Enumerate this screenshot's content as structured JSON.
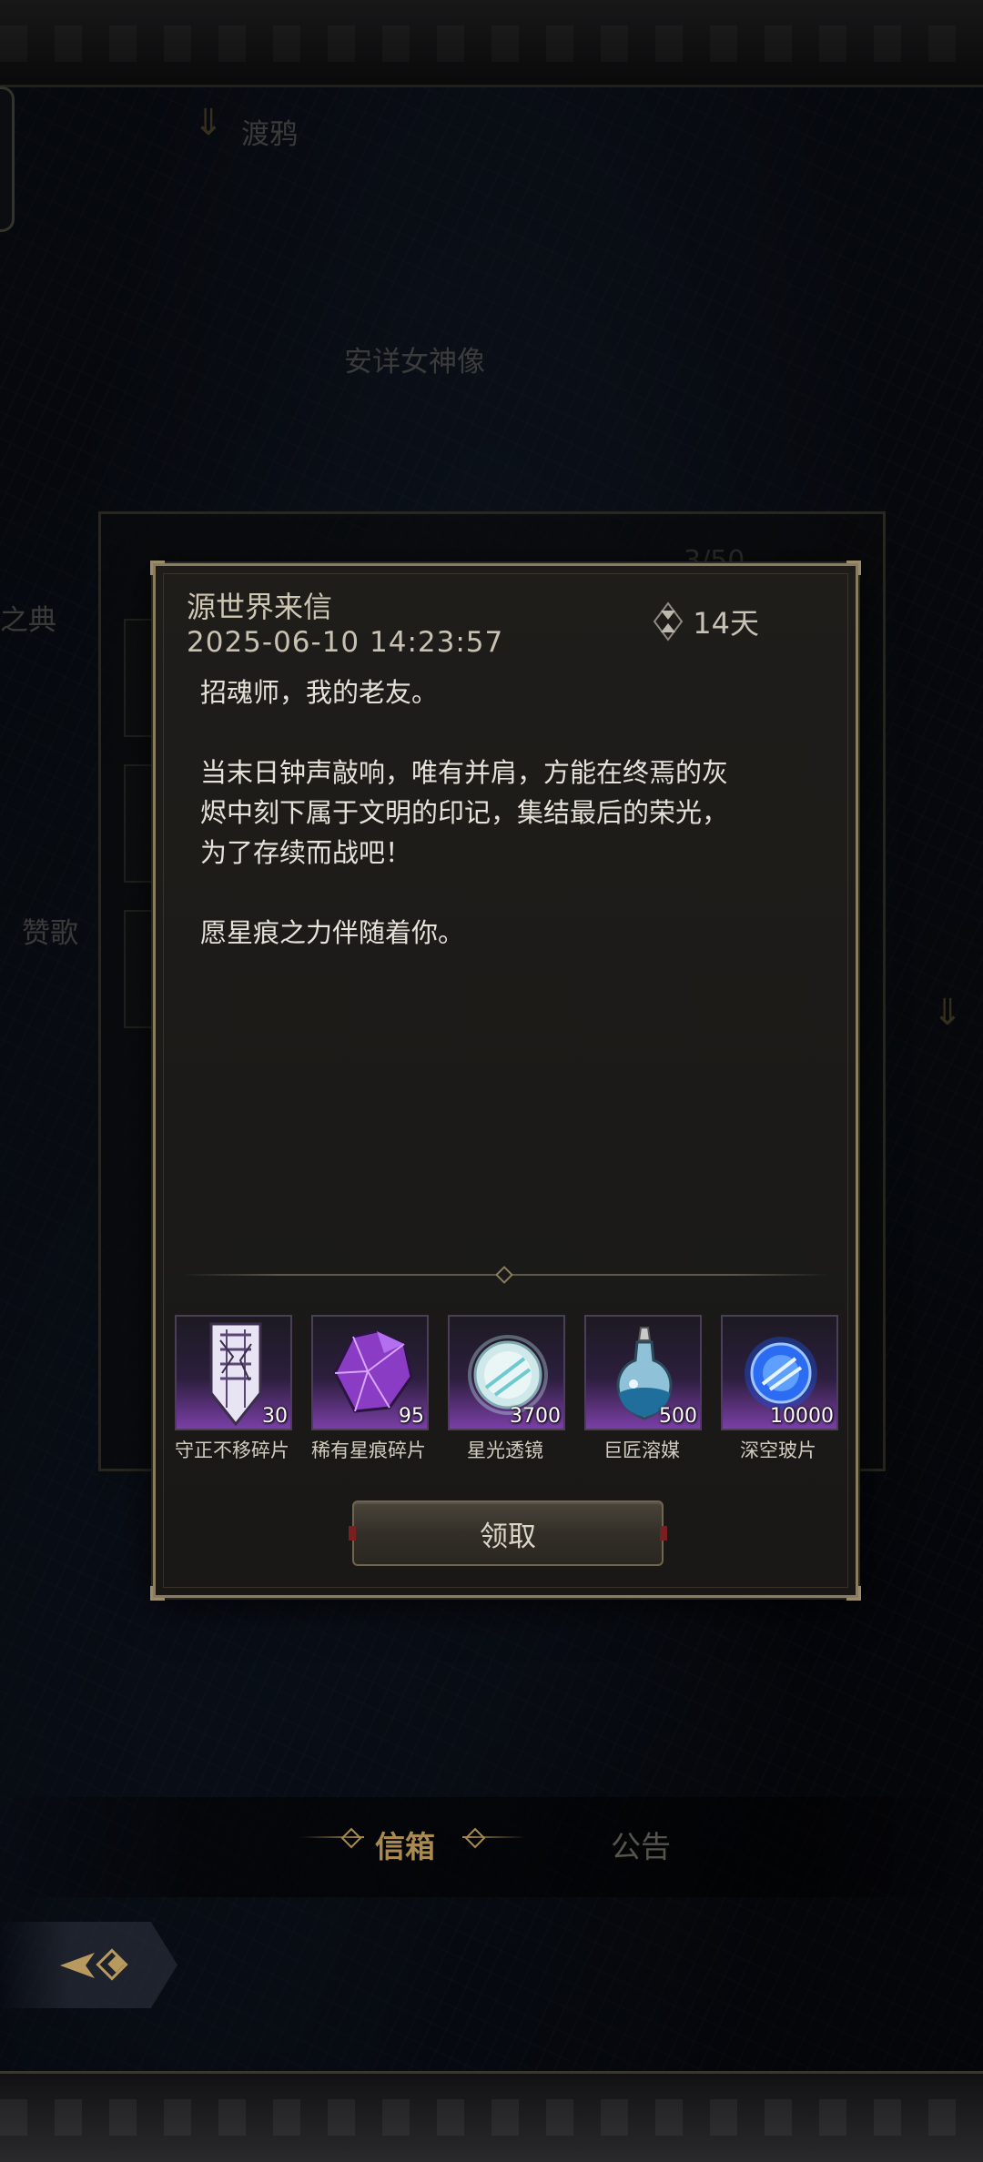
{
  "background": {
    "top_label": "渡鸦",
    "statue_label": "安详女神像",
    "side_label_top": "之典",
    "side_label_mid": "赞歌",
    "panel_counter": "3/50"
  },
  "tabs": [
    {
      "label": "信箱",
      "active": true
    },
    {
      "label": "公告",
      "active": false
    }
  ],
  "mail": {
    "title": "源世界来信",
    "date": "2025-06-10 14:23:57",
    "expire": "14天",
    "body": [
      "招魂师，我的老友。",
      "当末日钟声敲响，唯有并肩，方能在终焉的灰\n烬中刻下属于文明的印记，集结最后的荣光，\n为了存续而战吧！",
      "愿星痕之力伴随着你。"
    ],
    "rewards": [
      {
        "name": "守正不移碎片",
        "count": "30",
        "icon": "banner-shard-icon"
      },
      {
        "name": "稀有星痕碎片",
        "count": "95",
        "icon": "purple-crystal-icon"
      },
      {
        "name": "星光透镜",
        "count": "3700",
        "icon": "starlight-lens-icon"
      },
      {
        "name": "巨匠溶媒",
        "count": "500",
        "icon": "potion-flask-icon"
      },
      {
        "name": "深空玻片",
        "count": "10000",
        "icon": "blue-orb-icon"
      }
    ],
    "claim_label": "领取"
  },
  "colors": {
    "accent_gold": "#a98a52",
    "dialog_border": "#8a7c5e",
    "rarity_purple": "#7a3fa6"
  }
}
